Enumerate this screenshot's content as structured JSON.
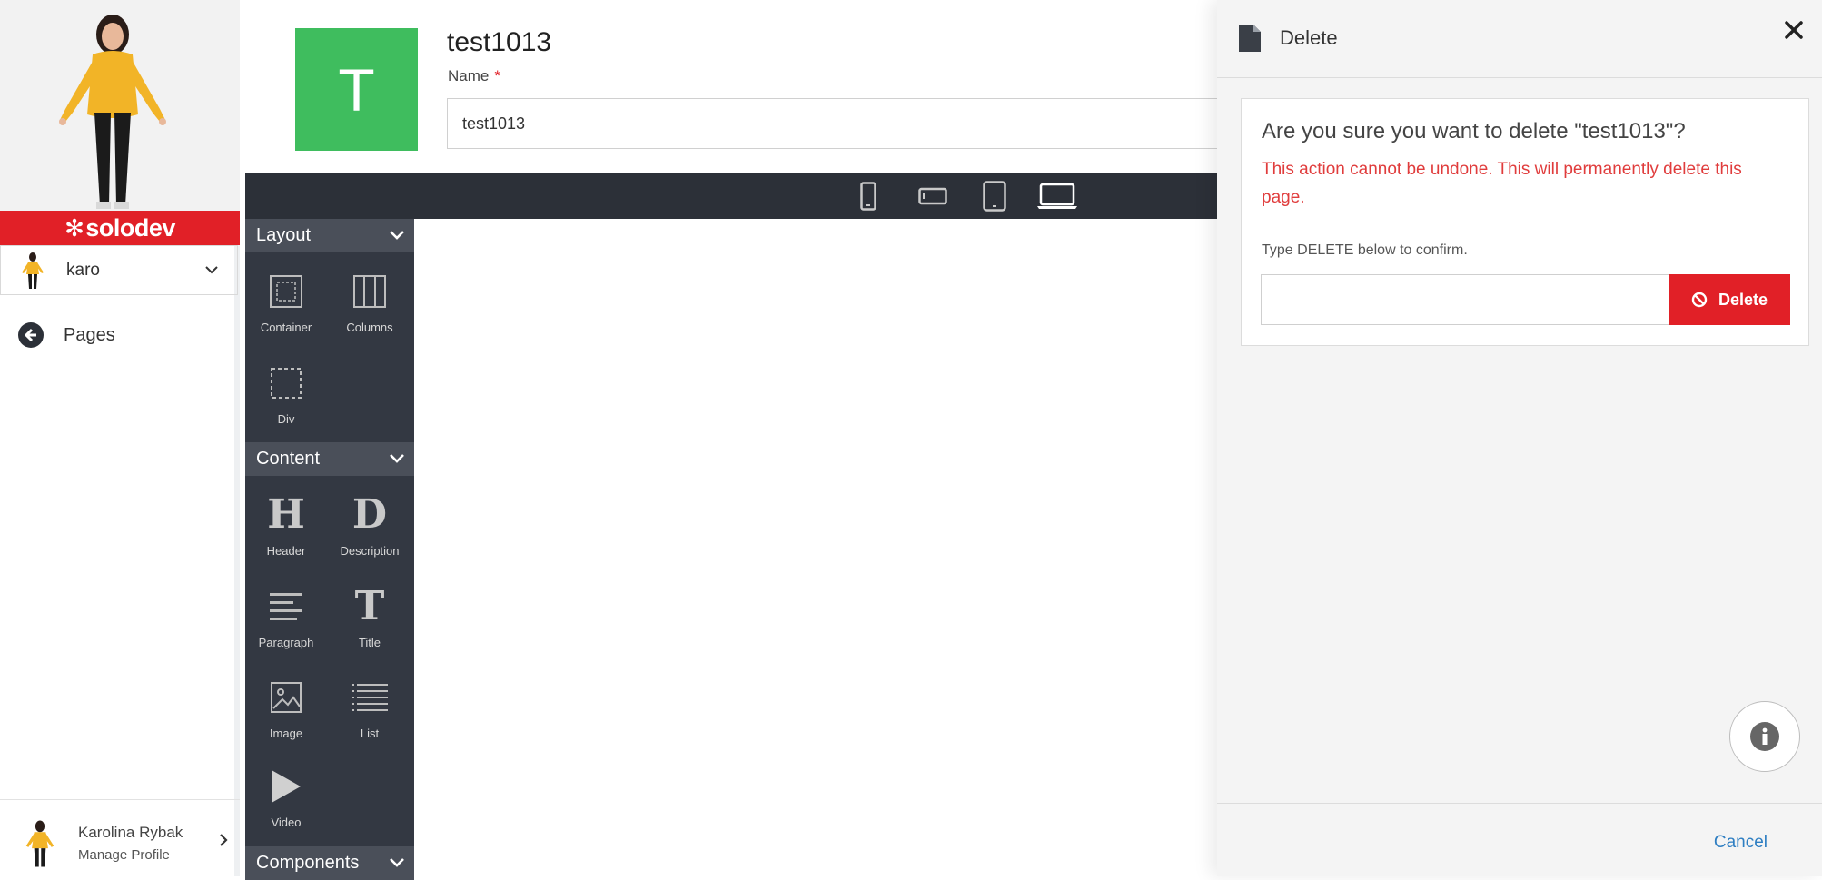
{
  "colors": {
    "brand_red": "#e12027",
    "page_tile_green": "#3fbd5e",
    "dark_bar": "#2c3038",
    "link_blue": "#2e7ec2",
    "warning_red": "#e03c3c"
  },
  "sidebar": {
    "brand": "solodev",
    "account_name": "karo",
    "nav_back_label": "Pages",
    "profile": {
      "name": "Karolina Rybak",
      "manage_label": "Manage Profile"
    }
  },
  "page": {
    "tile_letter": "T",
    "title": "test1013",
    "name_label": "Name",
    "name_required_mark": "*",
    "name_value": "test1013"
  },
  "device_toolbar": {
    "icons": [
      "mobile-portrait-icon",
      "mobile-landscape-icon",
      "tablet-icon",
      "laptop-icon"
    ]
  },
  "palette": {
    "sections": [
      {
        "title": "Layout",
        "items": [
          "Container",
          "Columns",
          "Div"
        ]
      },
      {
        "title": "Content",
        "items": [
          "Header",
          "Description",
          "Paragraph",
          "Title",
          "Image",
          "List",
          "Video"
        ]
      },
      {
        "title": "Components",
        "items": []
      }
    ],
    "header_letter": "H",
    "description_letter": "D",
    "title_letter": "T"
  },
  "delete_panel": {
    "title": "Delete",
    "question": "Are you sure you want to delete \"test1013\"?",
    "warning": "This action cannot be undone. This will permanently delete this page.",
    "instruction": "Type DELETE below to confirm.",
    "input_value": "",
    "delete_button": "Delete",
    "cancel_label": "Cancel"
  }
}
